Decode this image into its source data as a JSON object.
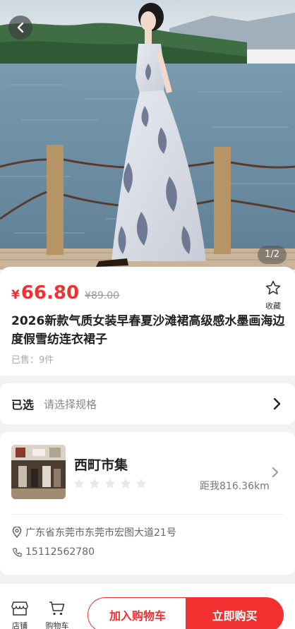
{
  "hero": {
    "counter": "1/2",
    "icons": {
      "back": "chevron-left-icon"
    }
  },
  "product": {
    "currency": "¥",
    "price": "66.80",
    "original_price": "¥89.00",
    "favorite_label": "收藏",
    "title": "2026新款气质女装早春夏沙滩裙高级感水墨画海边度假雪纺连衣裙子",
    "sold": "已售：9件",
    "icons": {
      "favorite": "star-outline-icon"
    }
  },
  "spec": {
    "label": "已选",
    "value": "请选择规格"
  },
  "shop": {
    "name": "西町市集",
    "rating": 0,
    "rating_max": 5,
    "distance": "距我816.36km",
    "address": "广东省东莞市东莞市宏图大道21号",
    "phone": "15112562780",
    "icons": {
      "address": "location-pin-icon",
      "phone": "phone-icon"
    }
  },
  "bottom_bar": {
    "store_label": "店铺",
    "cart_label": "购物车",
    "add_to_cart": "加入购物车",
    "buy_now": "立即购买",
    "icons": {
      "store": "store-icon",
      "cart": "cart-icon"
    }
  },
  "colors": {
    "accent": "#f23030",
    "muted": "#999999",
    "background": "#f2f2f2"
  }
}
